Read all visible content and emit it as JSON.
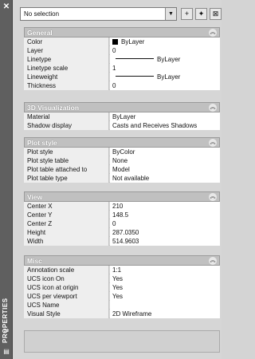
{
  "window": {
    "title": "PROPERTIES"
  },
  "toolbar": {
    "selection_value": "No selection",
    "btn_toggle_pickadd_label": "+",
    "btn_select_objects_label": "✦",
    "btn_quick_select_label": "⊠"
  },
  "sections": [
    {
      "title": "General",
      "rows": [
        {
          "key": "Color",
          "value": "ByLayer"
        },
        {
          "key": "Layer",
          "value": "0"
        },
        {
          "key": "Linetype",
          "value": "ByLayer"
        },
        {
          "key": "Linetype scale",
          "value": "1"
        },
        {
          "key": "Lineweight",
          "value": "ByLayer"
        },
        {
          "key": "Thickness",
          "value": "0"
        }
      ]
    },
    {
      "title": "3D Visualization",
      "rows": [
        {
          "key": "Material",
          "value": "ByLayer"
        },
        {
          "key": "Shadow display",
          "value": "Casts and Receives Shadows"
        }
      ]
    },
    {
      "title": "Plot style",
      "rows": [
        {
          "key": "Plot style",
          "value": "ByColor"
        },
        {
          "key": "Plot style table",
          "value": "None"
        },
        {
          "key": "Plot table attached to",
          "value": "Model"
        },
        {
          "key": "Plot table type",
          "value": "Not available"
        }
      ]
    },
    {
      "title": "View",
      "rows": [
        {
          "key": "Center X",
          "value": "210"
        },
        {
          "key": "Center Y",
          "value": "148.5"
        },
        {
          "key": "Center Z",
          "value": "0"
        },
        {
          "key": "Height",
          "value": "287.0350"
        },
        {
          "key": "Width",
          "value": "514.9603"
        }
      ]
    },
    {
      "title": "Misc",
      "rows": [
        {
          "key": "Annotation scale",
          "value": "1:1"
        },
        {
          "key": "UCS icon On",
          "value": "Yes"
        },
        {
          "key": "UCS icon at origin",
          "value": "Yes"
        },
        {
          "key": "UCS per viewport",
          "value": "Yes"
        },
        {
          "key": "UCS Name",
          "value": ""
        },
        {
          "key": "Visual Style",
          "value": "2D Wireframe"
        }
      ]
    }
  ],
  "icons": {
    "close": "close-icon",
    "autohide": "autohide-icon",
    "menu": "properties-menu-icon",
    "collapse": "chevron-up-icon",
    "dropdown": "chevron-down-icon"
  },
  "colors": {
    "titlebar": "#5f5f5f",
    "section_header": "#c0c0c0",
    "color_swatch": "#000000"
  }
}
